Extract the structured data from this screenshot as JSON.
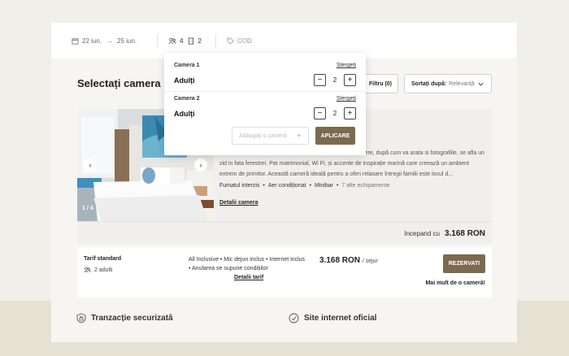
{
  "search_bar": {
    "checkin": "22 iun.",
    "checkout": "25 iun.",
    "adults_count": "4",
    "rooms_count": "2",
    "code_placeholder": "COD"
  },
  "main": {
    "title": "Selectați camera 1",
    "filter_label": "Filtru (0)",
    "sort_label": "Sortați după:",
    "sort_value": "Relevanță"
  },
  "room": {
    "image_counter": "1 / 4",
    "description": "Această cameră ne este dotată cu balcon si fereastre vedere, după cum va arata si fotografiile, se afla un zid in fata ferestrei. Pat matrimonial, Wi Fi, și accente de inspirație marină care creează un ambient extrem de primitor. Această cameră ideală pentru a oferi relaxare întregii familii este locul d...",
    "amenities": [
      "Fumatul interzis",
      "Aer condiționat",
      "Minibar"
    ],
    "more_amenities": "7 alte echipamente",
    "details_link": "Detalii camera",
    "starting_label": "Incepand cu",
    "starting_price": "3.168 RON"
  },
  "rate": {
    "name": "Tarif standard",
    "adults": "2 adulti",
    "inclusions_line1": "All Inclusive • Mic dejun inclus • Internet inclus",
    "inclusions_line2": "• Anularea se supune condițiilor",
    "details_link": "Detalii tarif",
    "price": "3.168 RON",
    "price_unit": "/ sejur",
    "reserve_label": "REZERVATI",
    "more_rooms": "Mai mult de o cameră!"
  },
  "footer": {
    "secure": "Tranzacție securizată",
    "official": "Site internet oficial"
  },
  "dropdown": {
    "rooms": [
      {
        "label": "Camera 1",
        "remove": "Ștergeți",
        "adults_label": "Adulți",
        "adults": "2"
      },
      {
        "label": "Camera 2",
        "remove": "Ștergeți",
        "adults_label": "Adulți",
        "adults": "2"
      }
    ],
    "add_room": "Adăugați o cameră",
    "apply": "APLICARE"
  },
  "colors": {
    "accent": "#7c6a4f",
    "background": "#f1efe9"
  }
}
